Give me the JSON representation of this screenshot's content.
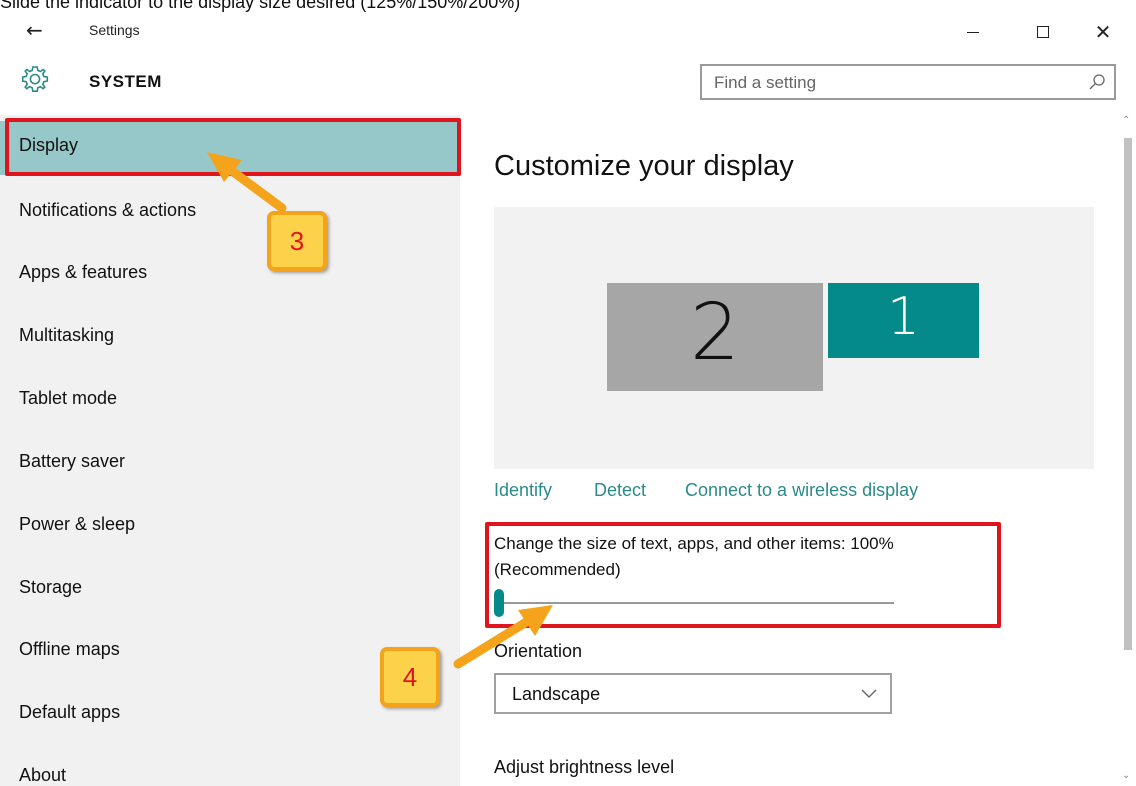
{
  "caption": "Slide the indicator to the display size desired (125%/150%/200%)",
  "window": {
    "title": "Settings",
    "back_icon": "back-arrow-icon",
    "minimize_icon": "minimize-icon",
    "maximize_icon": "maximize-icon",
    "close_icon": "close-icon"
  },
  "header": {
    "icon": "gear-icon",
    "title": "SYSTEM",
    "search_placeholder": "Find a setting",
    "search_icon": "search-icon"
  },
  "sidebar": {
    "items": [
      {
        "label": "Display",
        "selected": true
      },
      {
        "label": "Notifications & actions"
      },
      {
        "label": "Apps & features"
      },
      {
        "label": "Multitasking"
      },
      {
        "label": "Tablet mode"
      },
      {
        "label": "Battery saver"
      },
      {
        "label": "Power & sleep"
      },
      {
        "label": "Storage"
      },
      {
        "label": "Offline maps"
      },
      {
        "label": "Default apps"
      },
      {
        "label": "About"
      }
    ]
  },
  "main": {
    "title": "Customize your display",
    "monitors": [
      {
        "number": "2"
      },
      {
        "number": "1",
        "selected": true
      }
    ],
    "links": {
      "identify": "Identify",
      "detect": "Detect",
      "wireless": "Connect to a wireless display"
    },
    "size_label": "Change the size of text, apps, and other items: 100% (Recommended)",
    "size_slider_value": 0,
    "orientation_label": "Orientation",
    "orientation_value": "Landscape",
    "brightness_label": "Adjust brightness level"
  },
  "annotations": {
    "step3": "3",
    "step4": "4"
  },
  "colors": {
    "accent": "#058a8a",
    "selected_bg": "#97c8c9",
    "highlight_border": "#e0141c",
    "badge_fill": "#fbd24a",
    "arrow": "#f4a31b"
  }
}
